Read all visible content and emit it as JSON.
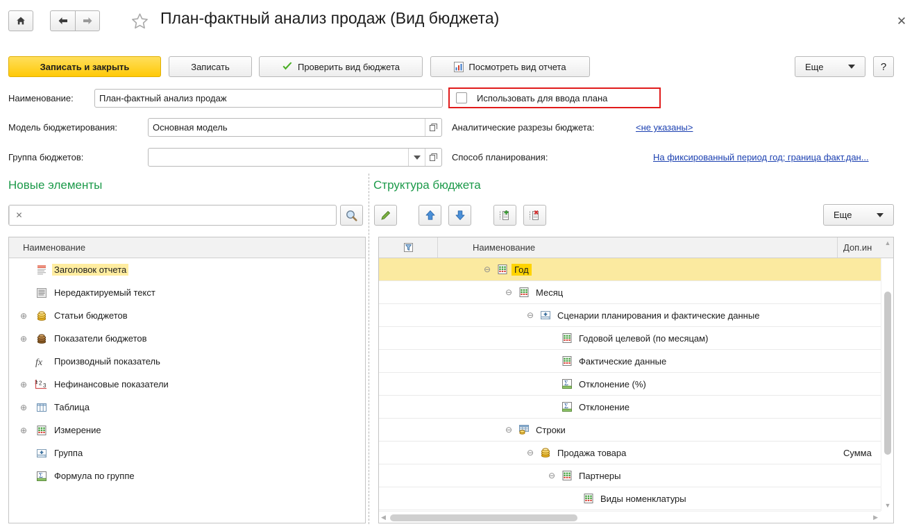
{
  "window": {
    "title": "План-фактный анализ продаж (Вид бюджета)",
    "close_label": "✕",
    "home_icon": "home-icon",
    "back_icon": "arrow-left-icon",
    "forward_icon": "arrow-right-icon",
    "favorite_icon": "star-icon"
  },
  "toolbar": {
    "save_and_close": "Записать и закрыть",
    "save": "Записать",
    "check_budget_view": "Проверить вид бюджета",
    "preview_report_view": "Посмотреть вид отчета",
    "more": "Еще",
    "help": "?"
  },
  "form": {
    "name_label": "Наименование:",
    "name_value": "План-фактный анализ продаж",
    "use_for_plan_label": "Использовать для ввода плана",
    "use_for_plan_checked": false,
    "model_label": "Модель бюджетирования:",
    "model_value": "Основная модель",
    "analytics_label": "Аналитические разрезы бюджета:",
    "analytics_value": "<не указаны>",
    "group_label": "Группа бюджетов:",
    "group_value": "",
    "planning_method_label": "Способ планирования:",
    "planning_method_value": "На фиксированный период год;  граница факт.дан..."
  },
  "left_panel": {
    "heading": "Новые элементы",
    "search_value": "",
    "search_clear_icon": "clear-icon",
    "search_button_icon": "search-icon",
    "column_header": "Наименование",
    "items": [
      {
        "label": "Заголовок отчета",
        "icon": "report-title-icon",
        "expandable": false,
        "selected": true
      },
      {
        "label": "Нередактируемый текст",
        "icon": "static-text-icon",
        "expandable": false,
        "selected": false
      },
      {
        "label": "Статьи бюджетов",
        "icon": "budget-items-icon",
        "expandable": true,
        "selected": false
      },
      {
        "label": "Показатели бюджетов",
        "icon": "budget-indicators-icon",
        "expandable": true,
        "selected": false
      },
      {
        "label": "Производный показатель",
        "icon": "formula-fx-icon",
        "expandable": false,
        "selected": false
      },
      {
        "label": "Нефинансовые показатели",
        "icon": "numeric-123-icon",
        "expandable": true,
        "selected": false
      },
      {
        "label": "Таблица",
        "icon": "table-icon",
        "expandable": true,
        "selected": false
      },
      {
        "label": "Измерение",
        "icon": "dimension-icon",
        "expandable": true,
        "selected": false
      },
      {
        "label": "Группа",
        "icon": "group-icon",
        "expandable": false,
        "selected": false
      },
      {
        "label": "Формула по группе",
        "icon": "sum-formula-icon",
        "expandable": false,
        "selected": false
      }
    ]
  },
  "right_panel": {
    "heading": "Структура бюджета",
    "more": "Еще",
    "tools": [
      {
        "name": "edit-button",
        "icon": "pencil-icon"
      },
      {
        "name": "move-up-button",
        "icon": "arrow-up-icon"
      },
      {
        "name": "move-down-button",
        "icon": "arrow-down-icon"
      },
      {
        "name": "add-group-button",
        "icon": "add-group-icon"
      },
      {
        "name": "delete-group-button",
        "icon": "delete-group-icon"
      }
    ],
    "columns": {
      "filter": "filter-icon",
      "name": "Наименование",
      "extra": "Доп.ин"
    },
    "rows": [
      {
        "label": "Год",
        "icon": "dimension-icon",
        "indent": 0,
        "expander": "collapse",
        "highlight": true,
        "extra": ""
      },
      {
        "label": "Месяц",
        "icon": "dimension-icon",
        "indent": 1,
        "expander": "collapse",
        "highlight": false,
        "extra": ""
      },
      {
        "label": "Сценарии планирования и фактические данные",
        "icon": "group-icon",
        "indent": 2,
        "expander": "collapse",
        "highlight": false,
        "extra": ""
      },
      {
        "label": "Годовой целевой (по месяцам)",
        "icon": "dimension-icon",
        "indent": 3,
        "expander": "none",
        "highlight": false,
        "extra": ""
      },
      {
        "label": "Фактические данные",
        "icon": "dimension-icon",
        "indent": 3,
        "expander": "none",
        "highlight": false,
        "extra": ""
      },
      {
        "label": "Отклонение (%)",
        "icon": "sum-formula-icon",
        "indent": 3,
        "expander": "none",
        "highlight": false,
        "extra": ""
      },
      {
        "label": "Отклонение",
        "icon": "sum-formula-icon",
        "indent": 3,
        "expander": "none",
        "highlight": false,
        "extra": ""
      },
      {
        "label": "Строки",
        "icon": "rows-icon",
        "indent": 1,
        "expander": "collapse",
        "highlight": false,
        "extra": ""
      },
      {
        "label": "Продажа товара",
        "icon": "budget-items-icon",
        "indent": 2,
        "expander": "collapse",
        "highlight": false,
        "extra": "Сумма"
      },
      {
        "label": "Партнеры",
        "icon": "dimension-icon",
        "indent": 3,
        "expander": "collapse",
        "highlight": false,
        "extra": ""
      },
      {
        "label": "Виды номенклатуры",
        "icon": "dimension-icon",
        "indent": 4,
        "expander": "none",
        "highlight": false,
        "extra": ""
      }
    ]
  },
  "colors": {
    "accent_yellow": "#ffc907",
    "section_green": "#1c9a4a",
    "link_blue": "#1a3fb0",
    "alert_red": "#e01b1b",
    "row_highlight": "#fbeaa0",
    "selection_yellow": "#ffd400"
  }
}
